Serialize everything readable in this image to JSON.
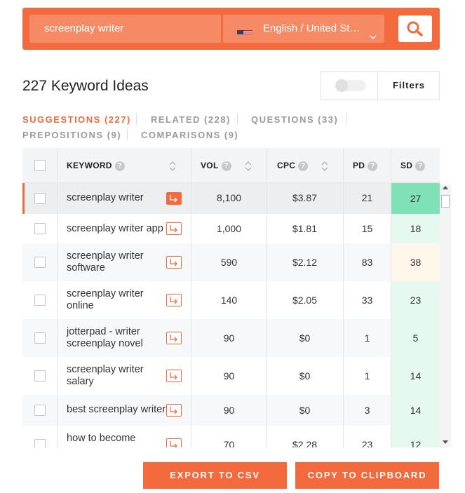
{
  "search": {
    "query": "screenplay writer",
    "language": "English / United Sta...",
    "flag_icon": "us-flag-icon",
    "search_icon": "search-icon"
  },
  "heading": "227 Keyword Ideas",
  "filters": {
    "label": "Filters",
    "toggle_on": false
  },
  "tabs": [
    {
      "label": "SUGGESTIONS (227)",
      "active": true
    },
    {
      "label": "RELATED (228)",
      "active": false
    },
    {
      "label": "QUESTIONS (33)",
      "active": false
    },
    {
      "label": "PREPOSITIONS (9)",
      "active": false
    },
    {
      "label": "COMPARISONS (9)",
      "active": false
    }
  ],
  "table": {
    "headers": {
      "keyword": "KEYWORD",
      "vol": "VOL",
      "cpc": "CPC",
      "pd": "PD",
      "sd": "SD",
      "help": "?"
    },
    "rows": [
      {
        "line1": "screenplay writer",
        "line2": "",
        "vol": "8,100",
        "cpc": "$3.87",
        "pd": "21",
        "sd": "27"
      },
      {
        "line1": "screenplay writer app",
        "line2": "",
        "vol": "1,000",
        "cpc": "$1.81",
        "pd": "15",
        "sd": "18"
      },
      {
        "line1": "screenplay writer",
        "line2": "software",
        "vol": "590",
        "cpc": "$2.12",
        "pd": "83",
        "sd": "38"
      },
      {
        "line1": "screenplay writer",
        "line2": "online",
        "vol": "140",
        "cpc": "$2.05",
        "pd": "33",
        "sd": "23"
      },
      {
        "line1": "jotterpad - writer",
        "line2": "screenplay novel",
        "vol": "90",
        "cpc": "$0",
        "pd": "1",
        "sd": "5"
      },
      {
        "line1": "screenplay writer",
        "line2": "salary",
        "vol": "90",
        "cpc": "$0",
        "pd": "1",
        "sd": "14"
      },
      {
        "line1": "best screenplay writer",
        "line2": "",
        "vol": "90",
        "cpc": "$0",
        "pd": "3",
        "sd": "14"
      },
      {
        "line1": "how to become",
        "line2": "",
        "vol": "70",
        "cpc": "$2.28",
        "pd": "23",
        "sd": "12"
      }
    ]
  },
  "colors": {
    "accent": "#f26a3d",
    "sd_easy": "#e6f9f0",
    "sd_easy_strong": "#7ee2b6",
    "sd_medium": "#fef7ea"
  },
  "actions": {
    "export_label": "EXPORT TO CSV",
    "copy_label": "COPY TO CLIPBOARD"
  }
}
